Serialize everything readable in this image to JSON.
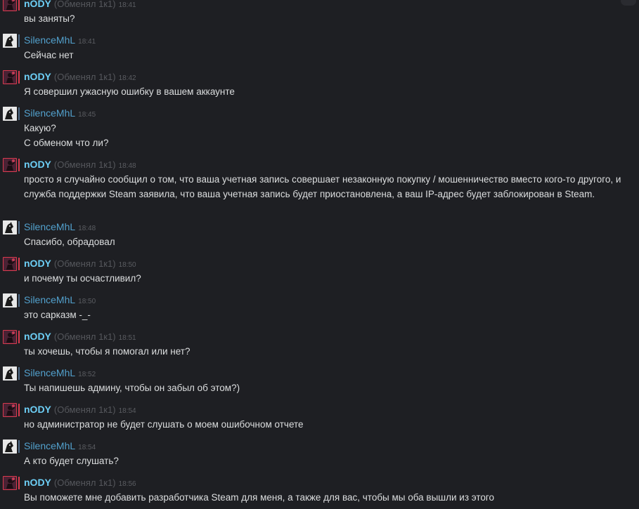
{
  "colors": {
    "background": "#1e1f23",
    "author_nody": "#6dcff6",
    "author_silence": "#52a0cc",
    "message_text": "#dcdedf",
    "meta_text": "#5b5d62"
  },
  "messages": [
    {
      "author": "nODY",
      "status": "(Обменял 1к1)",
      "time": "18:41",
      "lines": [
        "вы заняты?"
      ]
    },
    {
      "author": "SilenceMhL",
      "status": "",
      "time": "18:41",
      "lines": [
        "Сейчас нет"
      ]
    },
    {
      "author": "nODY",
      "status": "(Обменял 1к1)",
      "time": "18:42",
      "lines": [
        "Я совершил ужасную ошибку в вашем аккаунте"
      ]
    },
    {
      "author": "SilenceMhL",
      "status": "",
      "time": "18:45",
      "lines": [
        "Какую?",
        "С обменом что ли?"
      ]
    },
    {
      "author": "nODY",
      "status": "(Обменял 1к1)",
      "time": "18:48",
      "lines": [
        "просто я случайно сообщил о том, что ваша учетная запись совершает незаконную покупку / мошенничество вместо кого-то другого, и служба поддержки Steam заявила, что ваша учетная запись будет приостановлена, а ваш IP-адрес будет заблокирован в Steam."
      ]
    },
    {
      "author": "SilenceMhL",
      "status": "",
      "time": "18:48",
      "lines": [
        "Спасибо, обрадовал"
      ]
    },
    {
      "author": "nODY",
      "status": "(Обменял 1к1)",
      "time": "18:50",
      "lines": [
        "и почему ты осчастливил?"
      ]
    },
    {
      "author": "SilenceMhL",
      "status": "",
      "time": "18:50",
      "lines": [
        "это сарказм -_-"
      ]
    },
    {
      "author": "nODY",
      "status": "(Обменял 1к1)",
      "time": "18:51",
      "lines": [
        "ты хочешь, чтобы я помогал или нет?"
      ]
    },
    {
      "author": "SilenceMhL",
      "status": "",
      "time": "18:52",
      "lines": [
        "Ты напишешь админу, чтобы он забыл об этом?)"
      ]
    },
    {
      "author": "nODY",
      "status": "(Обменял 1к1)",
      "time": "18:54",
      "lines": [
        "но администратор не будет слушать о моем ошибочном отчете"
      ]
    },
    {
      "author": "SilenceMhL",
      "status": "",
      "time": "18:54",
      "lines": [
        "А кто будет слушать?"
      ]
    },
    {
      "author": "nODY",
      "status": "(Обменял 1к1)",
      "time": "18:56",
      "lines": [
        "Вы поможете мне добавить разработчика Steam для меня, а также для вас, чтобы мы оба вышли из этого"
      ]
    }
  ]
}
